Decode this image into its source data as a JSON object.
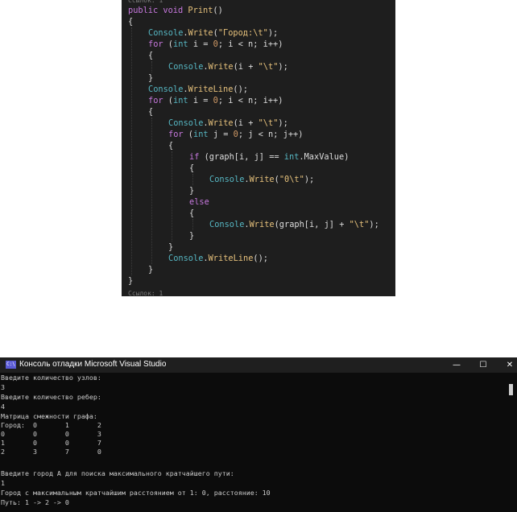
{
  "editor": {
    "codelens": "Ссылок: 1",
    "codelens_bottom": "Ссылок: 1",
    "signature": {
      "kw1": "public",
      "kw2": "void",
      "name": "Print",
      "rest": "()"
    },
    "brace_open": "{",
    "brace_close": "}",
    "stmt_write_header": {
      "cls": "Console",
      "dot": ".",
      "method": "Write",
      "open": "(",
      "str": "\"Город:\\t\"",
      "close": ");"
    },
    "for1": {
      "kw": "for",
      "a": " (",
      "type": "int",
      "b": " i = ",
      "zero": "0",
      "c": "; i < n; i++)"
    },
    "stmt_write_i": {
      "cls": "Console",
      "dot": ".",
      "method": "Write",
      "open": "(i + ",
      "str": "\"\\t\"",
      "close": ");"
    },
    "stmt_writeline": {
      "cls": "Console",
      "dot": ".",
      "method": "WriteLine",
      "rest": "();"
    },
    "for2": {
      "kw": "for",
      "a": " (",
      "type": "int",
      "b": " i = ",
      "zero": "0",
      "c": "; i < n; i++)"
    },
    "stmt_write_i2": {
      "cls": "Console",
      "dot": ".",
      "method": "Write",
      "open": "(i + ",
      "str": "\"\\t\"",
      "close": ");"
    },
    "for3": {
      "kw": "for",
      "a": " (",
      "type": "int",
      "b": " j = ",
      "zero": "0",
      "c": "; j < n; j++)"
    },
    "if_line": {
      "kw": "if",
      "a": " (graph[i, j] == ",
      "type": "int",
      "b": ".MaxValue)"
    },
    "stmt_write_zero": {
      "cls": "Console",
      "dot": ".",
      "method": "Write",
      "open": "(",
      "str": "\"0\\t\"",
      "close": ");"
    },
    "else_kw": "else",
    "stmt_write_graph": {
      "cls": "Console",
      "dot": ".",
      "method": "Write",
      "open": "(graph[i, j] + ",
      "str": "\"\\t\"",
      "close": ");"
    },
    "stmt_writeline2": {
      "cls": "Console",
      "dot": ".",
      "method": "WriteLine",
      "rest": "();"
    }
  },
  "console": {
    "title": "Консоль отладки Microsoft Visual Studio",
    "icon_text": "C:\\",
    "minimize": "—",
    "maximize": "☐",
    "close": "✕",
    "lines": [
      "Введите количество узлов:",
      "3",
      "Введите количество ребер:",
      "4",
      "Матрица смежности графа:",
      "Город:  0       1       2",
      "0       0       0       3",
      "1       0       0       7",
      "2       3       7       0",
      "",
      "Введите город А для поиска максимального кратчайшего пути:",
      "1",
      "Город с максимальным кратчайшим расстоянием от 1: 0, расстояние: 10",
      "Путь: 1 -> 2 -> 0"
    ]
  },
  "colors": {
    "editor_bg": "#1e1e1e",
    "console_bg": "#0c0c0c",
    "keyword": "#c678dd",
    "type": "#56b6c2",
    "method": "#e5c07b"
  }
}
